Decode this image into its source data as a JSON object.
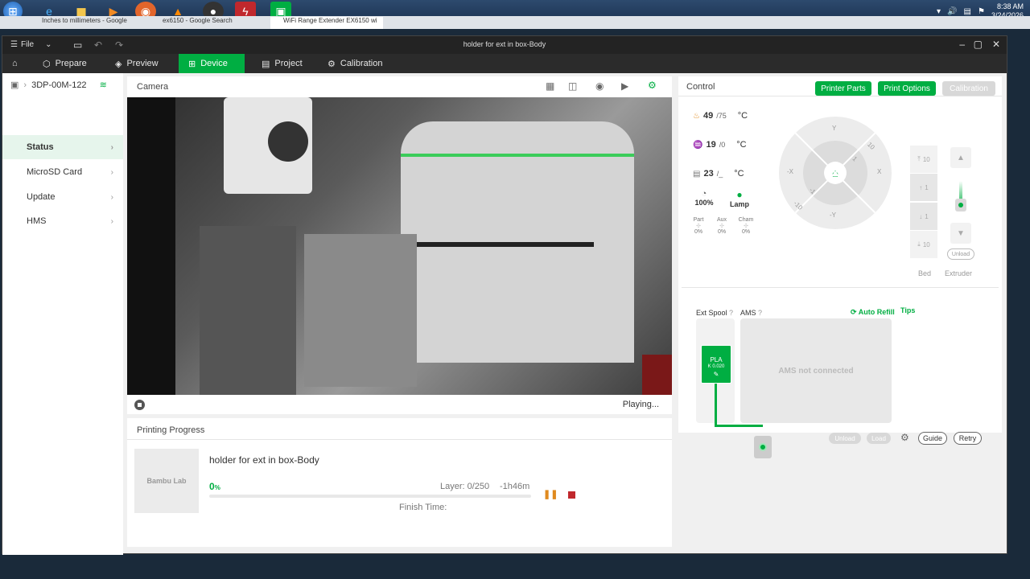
{
  "taskbar": {
    "clock_time": "8:38 AM",
    "clock_date": "3/24/2026"
  },
  "browser_tabs": [
    {
      "label": "Inches to millimeters - Google"
    },
    {
      "label": "ex6150 - Google Search"
    },
    {
      "label": "WiFi Range Extender EX6150 wi"
    }
  ],
  "window": {
    "title": "holder for ext in box-Body"
  },
  "menubar": {
    "file_label": "File",
    "tabs": [
      {
        "label": "Prepare",
        "icon": "cube-icon"
      },
      {
        "label": "Preview",
        "icon": "layers-icon"
      },
      {
        "label": "Device",
        "icon": "device-icon"
      },
      {
        "label": "Project",
        "icon": "project-icon"
      },
      {
        "label": "Calibration",
        "icon": "gear-icon"
      }
    ]
  },
  "sidebar": {
    "printer_name": "3DP-00M-122",
    "items": [
      {
        "label": "Status"
      },
      {
        "label": "MicroSD Card"
      },
      {
        "label": "Update"
      },
      {
        "label": "HMS"
      }
    ]
  },
  "camera": {
    "title": "Camera",
    "status": "Playing..."
  },
  "progress": {
    "title": "Printing Progress",
    "job_name": "holder for ext in box-Body",
    "percent": "0",
    "percent_unit": "%",
    "percent_value": 0,
    "layer": "Layer: 0/250",
    "time_left": "-1h46m",
    "finish_time_label": "Finish Time:",
    "thumbnail_logo": "Bambu Lab"
  },
  "control": {
    "title": "Control",
    "buttons": {
      "printer_parts": "Printer Parts",
      "print_options": "Print Options",
      "calibration": "Calibration"
    },
    "nozzle": {
      "current": "49",
      "target": "/75",
      "unit": "°C"
    },
    "bed": {
      "current": "19",
      "target": "/0",
      "unit": "°C"
    },
    "chamber": {
      "current": "23",
      "target": "/_",
      "unit": "°C"
    },
    "speed": "100%",
    "lamp": "Lamp",
    "fans": [
      {
        "label": "Part",
        "value": "0%"
      },
      {
        "label": "Aux",
        "value": "0%"
      },
      {
        "label": "Cham",
        "value": "0%"
      }
    ],
    "jog": {
      "y_plus": "Y",
      "y_minus": "-Y",
      "x_plus": "X",
      "x_minus": "-X",
      "plus10": "10",
      "plus1": "1",
      "minus1": "-1",
      "minus10": "-10"
    },
    "bed_steps": [
      "10",
      "1",
      "1",
      "10"
    ],
    "bed_label": "Bed",
    "extruder_label": "Extruder",
    "unload_small": "Unload"
  },
  "ams": {
    "ext_spool_label": "Ext Spool",
    "ams_label": "AMS",
    "auto_refill": "Auto Refill",
    "tips": "Tips",
    "filament_type": "PLA",
    "filament_k": "K 0.020",
    "not_connected": "AMS not connected",
    "unload": "Unload",
    "load": "Load",
    "guide": "Guide",
    "retry": "Retry",
    "accent_color": "#00ae42"
  }
}
